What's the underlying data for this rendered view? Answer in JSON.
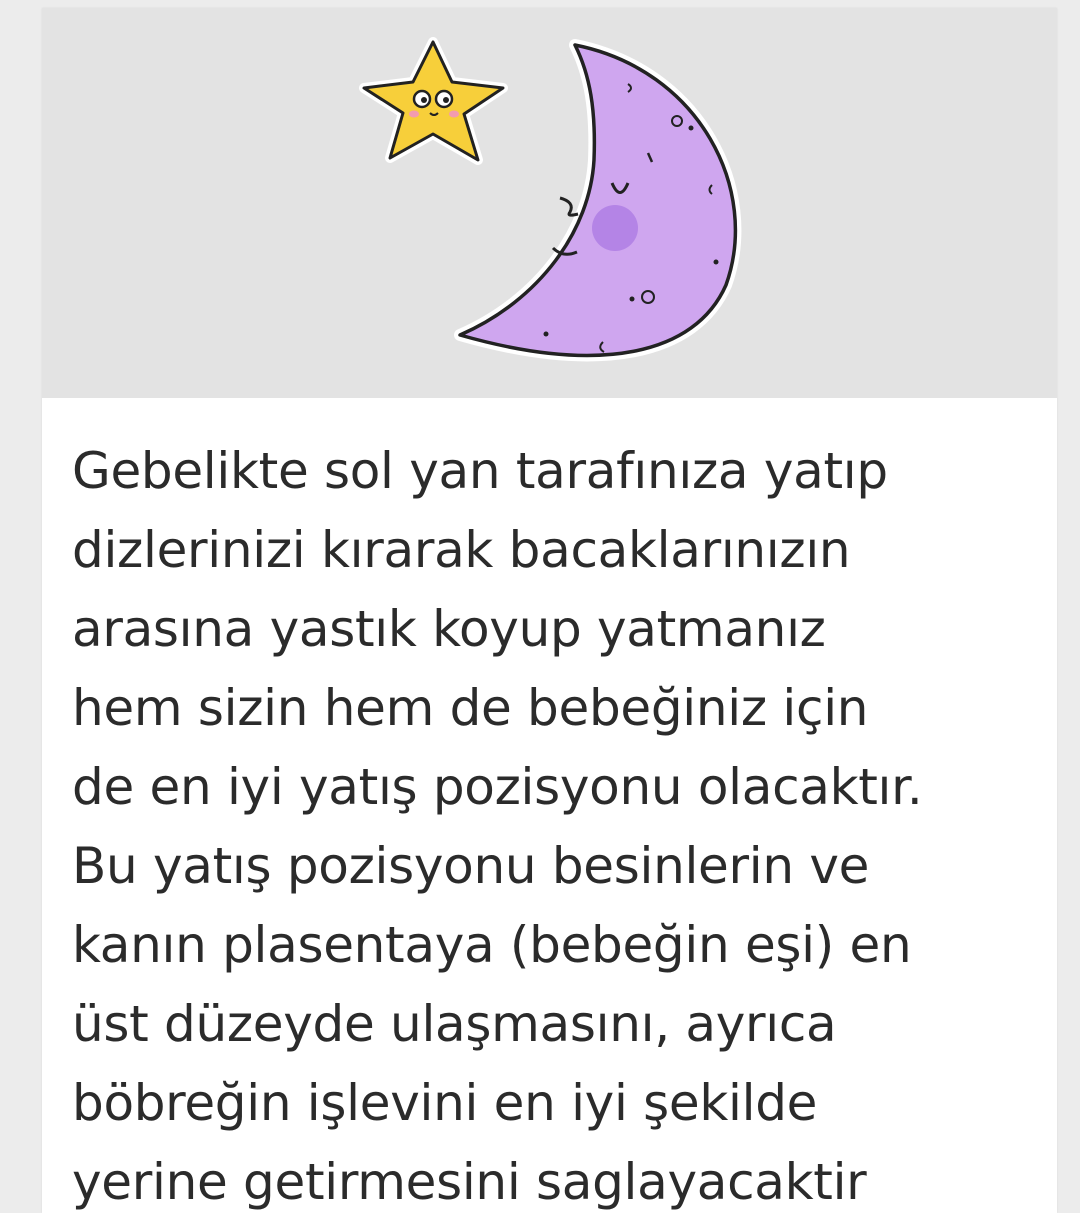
{
  "content": {
    "lines": [
      "Gebelikte sol yan tarafınıza yatıp",
      "dizlerinizi kırarak bacaklarınızın",
      "arasına yastık koyup yatmanız",
      "hem sizin hem de bebeğiniz için",
      "de en iyi yatış pozisyonu olacaktır.",
      "Bu yatış pozisyonu besinlerin ve",
      "kanın plasentaya (bebeğin eşi) en",
      "üst düzeyde ulaşmasını, ayrıca",
      "böbreğin işlevini en iyi şekilde",
      "yerine getirmesini saglayacaktir"
    ]
  },
  "illustration": {
    "icons": [
      "star-character-icon",
      "crescent-moon-character-icon"
    ],
    "colors": {
      "star": "#f7cf3a",
      "moon": "#cfa6ef",
      "moon_cheek": "#b484e6",
      "background": "#e3e3e3"
    }
  }
}
